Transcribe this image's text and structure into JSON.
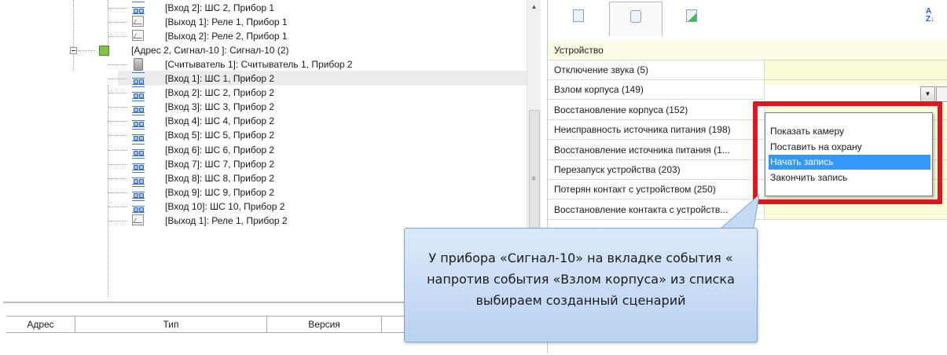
{
  "tree": {
    "items": [
      {
        "label": "[Вход 2]: ШС 2, Прибор 1",
        "icon": "input-icon"
      },
      {
        "label": "[Выход 1]: Реле 1, Прибор 1",
        "icon": "relay-icon"
      },
      {
        "label": "[Выход 2]: Реле 2, Прибор 1",
        "icon": "relay-icon"
      },
      {
        "label": "[Адрес 2, Сигнал-10 ]: Сигнал-10 (2)",
        "icon": "device-icon"
      },
      {
        "label": "[Считыватель 1]: Считыватель 1, Прибор 2",
        "icon": "reader-icon"
      },
      {
        "label": "[Вход 1]: ШС 1, Прибор 2",
        "icon": "input-icon"
      },
      {
        "label": "[Вход 2]: ШС 2, Прибор 2",
        "icon": "input-icon"
      },
      {
        "label": "[Вход 3]: ШС 3, Прибор 2",
        "icon": "input-icon"
      },
      {
        "label": "[Вход 4]: ШС 4, Прибор 2",
        "icon": "input-icon"
      },
      {
        "label": "[Вход 5]: ШС 5, Прибор 2",
        "icon": "input-icon"
      },
      {
        "label": "[Вход 6]: ШС 6, Прибор 2",
        "icon": "input-icon"
      },
      {
        "label": "[Вход 7]: ШС 7, Прибор 2",
        "icon": "input-icon"
      },
      {
        "label": "[Вход 8]: ШС 8, Прибор 2",
        "icon": "input-icon"
      },
      {
        "label": "[Вход 9]: ШС 9, Прибор 2",
        "icon": "input-icon"
      },
      {
        "label": "[Вход 10]: ШС 10, Прибор 2",
        "icon": "input-icon"
      },
      {
        "label": "[Выход 1]: Реле 1, Прибор 2",
        "icon": "relay-icon"
      }
    ]
  },
  "bottom_table": {
    "columns": [
      "Адрес",
      "Тип",
      "Версия"
    ]
  },
  "properties": {
    "section": "Устройство",
    "rows": [
      "Отключение звука (5)",
      "Взлом корпуса (149)",
      "Восстановление корпуса (152)",
      "Неисправность источника питания (198)",
      "Восстановление источника питания (1...",
      "Перезапуск устройства (203)",
      "Потерян контакт с устройством (250)",
      "Восстановление контакта с устройств..."
    ]
  },
  "dropdown": {
    "options": [
      "Показать камеру",
      "Поставить на охрану",
      "Начать запись",
      "Закончить запись"
    ],
    "highlighted": "Начать запись"
  },
  "callout": {
    "text": "У прибора «Сигнал-10» на вкладке события « напротив события «Взлом корпуса» из списка выбираем созданный сценарий"
  },
  "colors": {
    "highlight": "#3399ff",
    "frame": "#e0161e",
    "value_bg": "#fbfbd8",
    "callout_bg": "#c9dcf4"
  }
}
